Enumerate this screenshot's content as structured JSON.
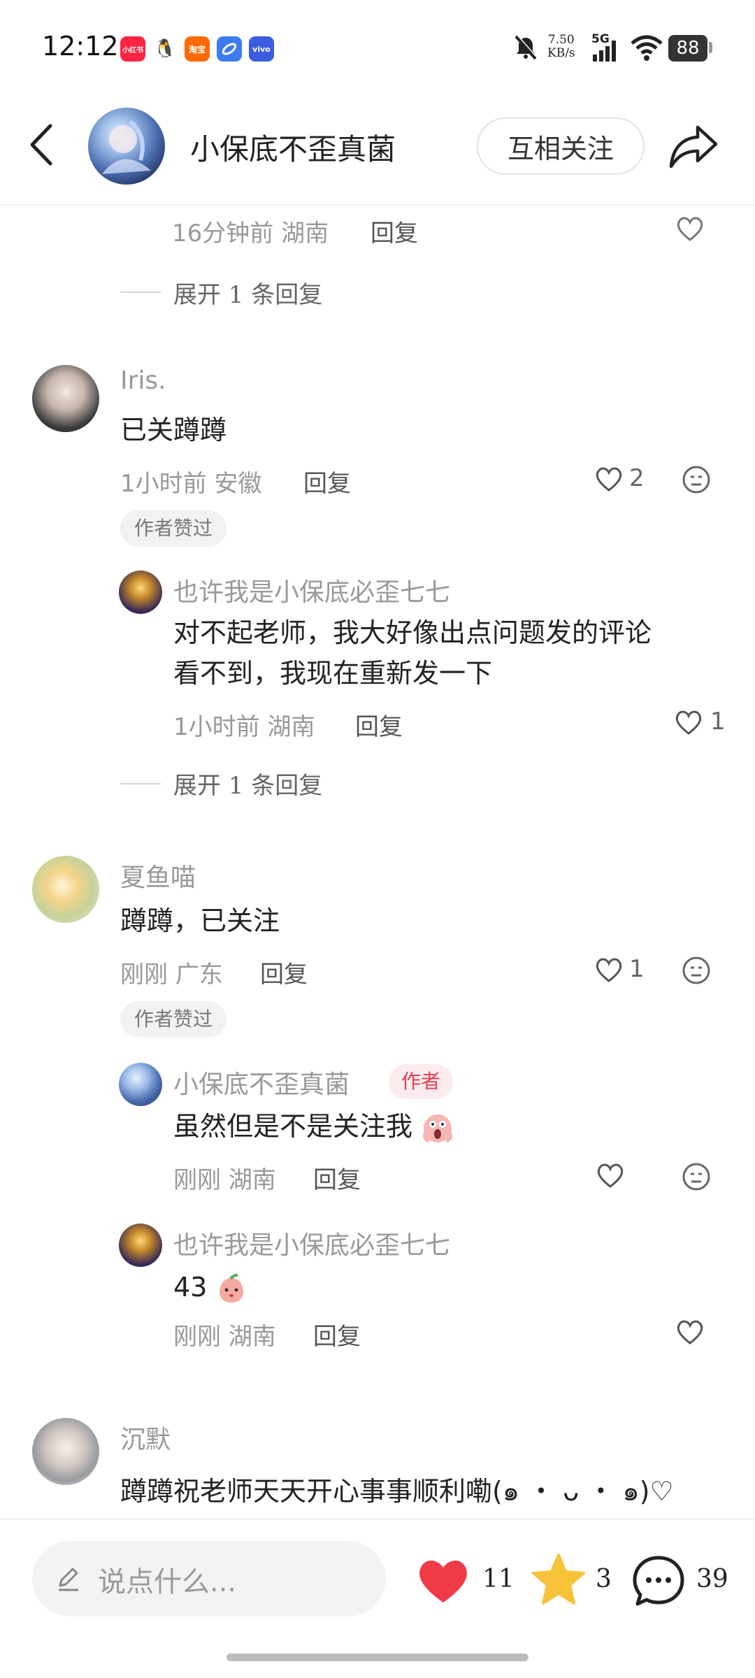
{
  "status_bar": {
    "time": "12:12",
    "apps": [
      "小红书",
      "QQ",
      "淘宝",
      "浏览器",
      "vivo"
    ],
    "net_speed_value": "7.50",
    "net_speed_unit": "KB/s",
    "network": "5G",
    "battery": "88"
  },
  "header": {
    "username": "小保底不歪真菌",
    "follow_label": "互相关注"
  },
  "top_fragment": {
    "time": "16分钟前",
    "location": "湖南",
    "reply": "回复",
    "expand": "展开 1 条回复"
  },
  "comments": [
    {
      "name": "Iris.",
      "text": "已关蹲蹲",
      "time": "1小时前",
      "location": "安徽",
      "reply": "回复",
      "likes": "2",
      "tag": "作者赞过",
      "sub_reply": {
        "name": "也许我是小保底必歪七七",
        "text_line1": "对不起老师，我大好像出点问题发的评论",
        "text_line2": "看不到，我现在重新发一下",
        "time": "1小时前",
        "location": "湖南",
        "reply": "回复",
        "likes": "1"
      },
      "expand": "展开 1 条回复"
    },
    {
      "name": "夏鱼喵",
      "text": "蹲蹲，已关注",
      "time": "刚刚",
      "location": "广东",
      "reply": "回复",
      "likes": "1",
      "tag": "作者赞过",
      "sub_replies": [
        {
          "name": "小保底不歪真菌",
          "author_tag": "作者",
          "text": "虽然但是不是关注我",
          "time": "刚刚",
          "location": "湖南",
          "reply": "回复"
        },
        {
          "name": "也许我是小保底必歪七七",
          "text": "43",
          "time": "刚刚",
          "location": "湖南",
          "reply": "回复"
        }
      ]
    },
    {
      "name": "沉默",
      "text": "蹲蹲祝老师天天开心事事顺利嘞(๑ ・ ᴗ ・ ๑)♡"
    }
  ],
  "bottom_bar": {
    "input_placeholder": "说点什么...",
    "likes": "11",
    "stars": "3",
    "comments": "39"
  },
  "colors": {
    "like_red": "#f03a47",
    "star_yellow": "#f7c33b",
    "author_tag_text": "#e0414f",
    "author_tag_bg": "#fdecee"
  },
  "icons": [
    "back-arrow-icon",
    "share-icon",
    "heart-icon",
    "dislike-face-icon",
    "pencil-icon",
    "star-icon",
    "chat-bubble-icon",
    "bell-muted-icon",
    "wifi-icon"
  ]
}
